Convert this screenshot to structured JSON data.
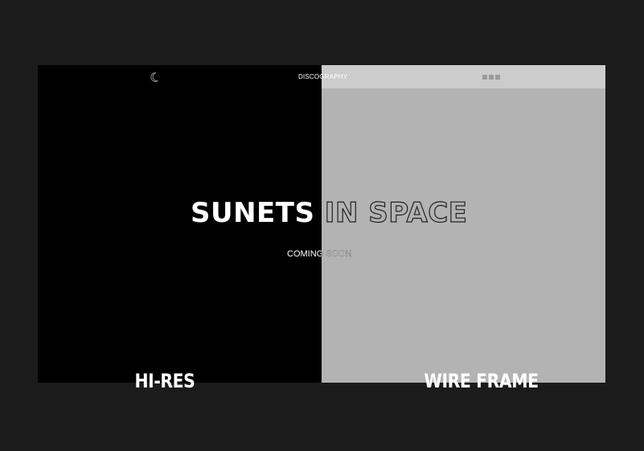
{
  "mockup": {
    "nav": {
      "label": "DISCOGRAPHY"
    },
    "hero": {
      "title": "SUNETS IN SPACE",
      "subtitle": "COMING SOON"
    },
    "icons": {
      "logo": "crescent-moon-icon",
      "menu": "menu-dots-icon"
    }
  },
  "captions": {
    "left": "HI-RES",
    "right": "WIRE FRAME"
  },
  "colors": {
    "background": "#1b1b1b",
    "hires_panel": "#000000",
    "wireframe_panel": "#b3b3b3",
    "wireframe_topbar": "#cccccc",
    "text": "#ffffff"
  }
}
